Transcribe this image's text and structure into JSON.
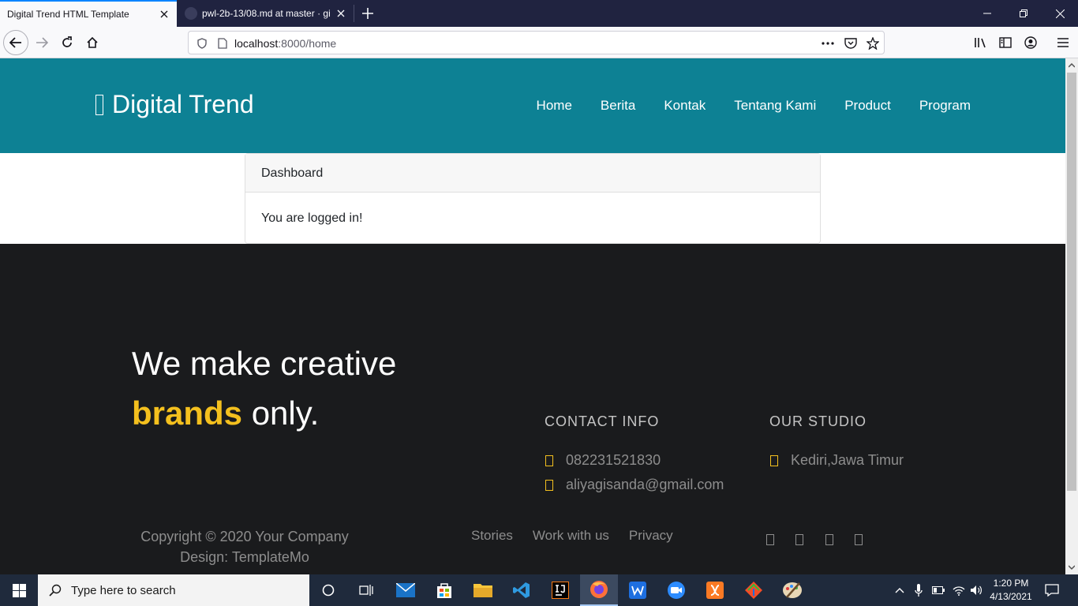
{
  "browser": {
    "tabs": [
      {
        "title": "Digital Trend HTML Template",
        "active": true
      },
      {
        "title": "pwl-2b-13/08.md at master · gi",
        "active": false
      }
    ],
    "url": {
      "host": "localhost",
      "path": ":8000/home"
    }
  },
  "site": {
    "brand": "Digital Trend",
    "menu": [
      "Home",
      "Berita",
      "Kontak",
      "Tentang Kami",
      "Product",
      "Program"
    ]
  },
  "card": {
    "header": "Dashboard",
    "body": "You are logged in!"
  },
  "footer": {
    "tagline_line1": "We make creative",
    "tagline_highlight": "brands",
    "tagline_rest": " only.",
    "contact_title": "CONTACT INFO",
    "phone": "082231521830",
    "email": "aliyagisanda@gmail.com",
    "studio_title": "OUR STUDIO",
    "studio_location": "Kediri,Jawa Timur",
    "copyright_line1": "Copyright © 2020 Your Company",
    "copyright_line2": "Design: TemplateMo",
    "links": [
      "Stories",
      "Work with us",
      "Privacy"
    ],
    "accent_color": "#f4c01e"
  },
  "taskbar": {
    "search_placeholder": "Type here to search",
    "time": "1:20 PM",
    "date": "4/13/2021"
  },
  "colors": {
    "header_bg": "#0d8194",
    "footer_bg": "#1a1b1d",
    "taskbar_bg": "#1f2a3c",
    "tabbar_bg": "#202340"
  }
}
